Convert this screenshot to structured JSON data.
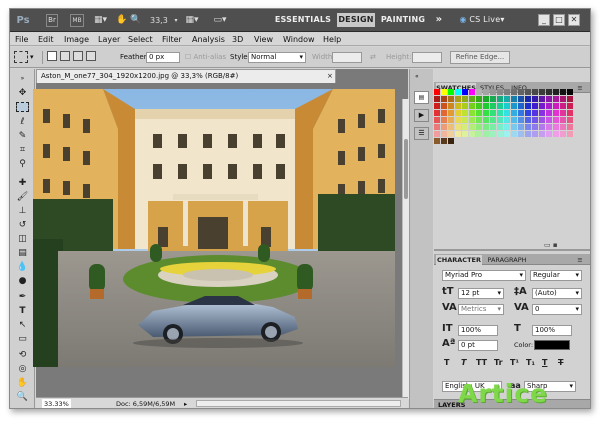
{
  "topbar": {
    "ps_logo": "Ps",
    "zoom": "33,3",
    "workspaces": [
      "ESSENTIALS",
      "DESIGN",
      "PAINTING"
    ],
    "more": "»",
    "cslive": "CS Live",
    "window_buttons": [
      "_",
      "□",
      "✕"
    ]
  },
  "menu": [
    "File",
    "Edit",
    "Image",
    "Layer",
    "Select",
    "Filter",
    "Analysis",
    "3D",
    "View",
    "Window",
    "Help"
  ],
  "options": {
    "feather_label": "Feather:",
    "feather_value": "0 px",
    "antialias_label": "Anti-alias",
    "style_label": "Style:",
    "style_value": "Normal",
    "width_label": "Width:",
    "height_label": "Height:",
    "refine_edge": "Refine Edge..."
  },
  "document": {
    "tab_title": "Aston_M_one77_304_1920x1200.jpg @ 33,3% (RGB/8#)",
    "zoom_status": "33.33%",
    "doc_info": "Doc: 6,59M/6,59M"
  },
  "panels": {
    "swatch_tabs": [
      "SWATCHES",
      "STYLES",
      "INFO"
    ],
    "char_tabs": [
      "CHARACTER",
      "PARAGRAPH"
    ],
    "font_family": "Myriad Pro",
    "font_style": "Regular",
    "font_size": "12 pt",
    "leading": "(Auto)",
    "kerning": "Metrics",
    "tracking": "0",
    "vertical_scale": "100%",
    "horizontal_scale": "100%",
    "baseline_shift": "0 pt",
    "color_label": "Color:",
    "text_style_buttons": [
      "T",
      "T",
      "TT",
      "Tr",
      "T¹",
      "T₁",
      "T",
      "T"
    ],
    "language": "English: UK",
    "antialias": "Sharp",
    "layers_tab": "LAYERS"
  },
  "watermark": "Artice",
  "colors": {
    "topbar": "#4f4f4f",
    "panel": "#d2d2d2",
    "watermark": "#7fd84a"
  }
}
